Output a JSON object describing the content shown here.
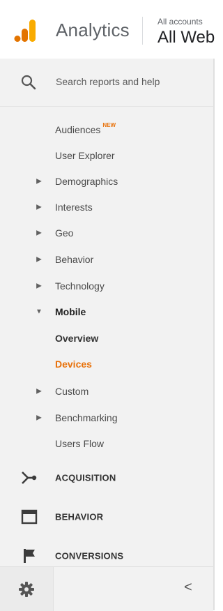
{
  "header": {
    "app_title": "Analytics",
    "account_label": "All accounts",
    "property_name": "All Web"
  },
  "search": {
    "placeholder": "Search reports and help"
  },
  "audience_items": [
    {
      "label": "Audiences",
      "badge": "NEW",
      "arrow": ""
    },
    {
      "label": "User Explorer",
      "arrow": ""
    },
    {
      "label": "Demographics",
      "arrow": "▶"
    },
    {
      "label": "Interests",
      "arrow": "▶"
    },
    {
      "label": "Geo",
      "arrow": "▶"
    },
    {
      "label": "Behavior",
      "arrow": "▶"
    },
    {
      "label": "Technology",
      "arrow": "▶"
    },
    {
      "label": "Mobile",
      "arrow": "▼"
    },
    {
      "label": "Overview",
      "arrow": ""
    },
    {
      "label": "Devices",
      "arrow": ""
    },
    {
      "label": "Custom",
      "arrow": "▶"
    },
    {
      "label": "Benchmarking",
      "arrow": "▶"
    },
    {
      "label": "Users Flow",
      "arrow": ""
    }
  ],
  "sections": {
    "acquisition": "ACQUISITION",
    "behavior": "BEHAVIOR",
    "conversions": "CONVERSIONS"
  },
  "footer": {
    "collapse_glyph": "<"
  },
  "colors": {
    "accent": "#e8710a",
    "logo_orange": "#f9ab00",
    "logo_dark_orange": "#e37400"
  }
}
